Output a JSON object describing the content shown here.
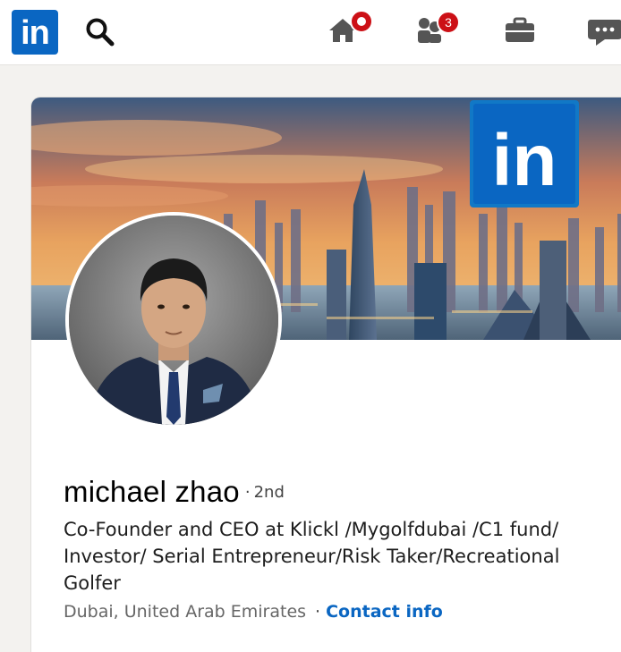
{
  "nav": {
    "logo_text": "in",
    "network_badge": "3",
    "brand_color": "#0a66c2",
    "badge_color": "#cc1016",
    "icons": [
      "search-icon",
      "home-icon",
      "my-network-icon",
      "jobs-icon",
      "messaging-icon"
    ]
  },
  "banner": {
    "logo_text": "in"
  },
  "profile": {
    "name": "michael zhao",
    "degree_sep": "·",
    "degree": "2nd",
    "headline": "Co-Founder and CEO at Klickl /Mygolfdubai /C1 fund/ Investor/ Serial Entrepreneur/Risk Taker/Recreational Golfer",
    "location": "Dubai, United Arab Emirates",
    "location_sep": "·",
    "contact_label": "Contact info"
  }
}
